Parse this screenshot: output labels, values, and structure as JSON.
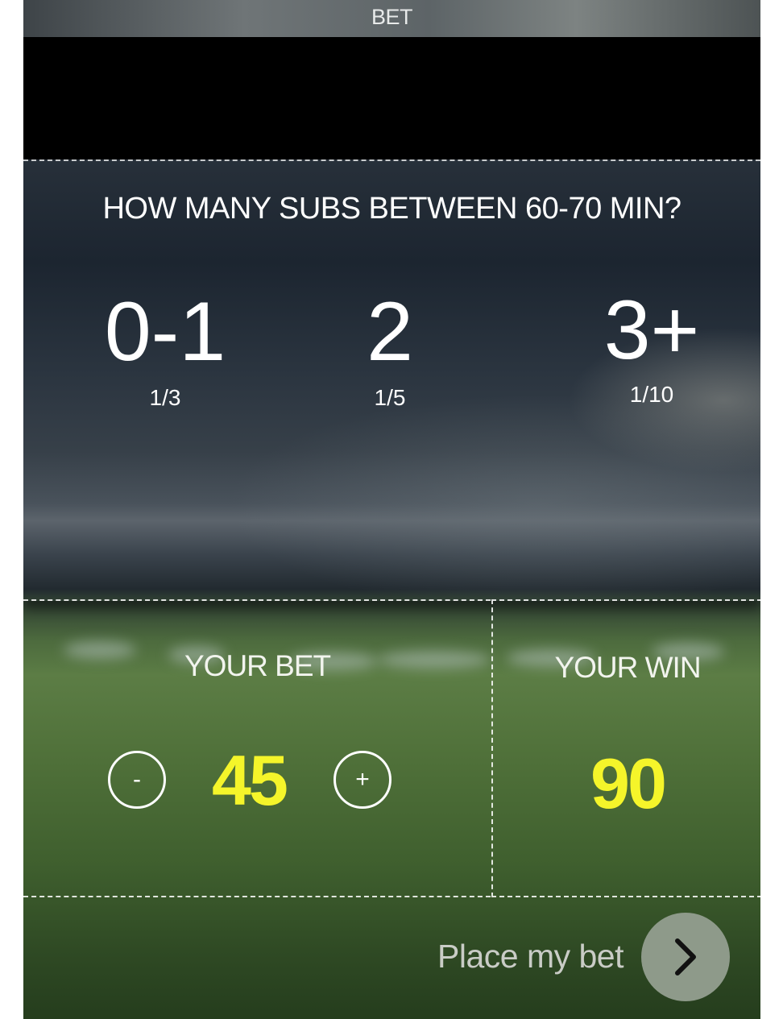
{
  "window": {
    "title": "BET"
  },
  "question": {
    "text": "HOW MANY SUBS BETWEEN 60-70 MIN?",
    "options": [
      {
        "label": "0-1",
        "odds": "1/3"
      },
      {
        "label": "2",
        "odds": "1/5"
      },
      {
        "label": "3+",
        "odds": "1/10"
      }
    ]
  },
  "bet": {
    "label": "YOUR BET",
    "value": "45",
    "decrement": "-",
    "increment": "+"
  },
  "win": {
    "label": "YOUR WIN",
    "value": "90"
  },
  "footer": {
    "place_label": "Place my bet",
    "button_icon": "chevron-right-icon"
  },
  "colors": {
    "accent_yellow": "#f5f52a",
    "text_white": "#ffffff",
    "button_grey": "#8e9a8a"
  }
}
